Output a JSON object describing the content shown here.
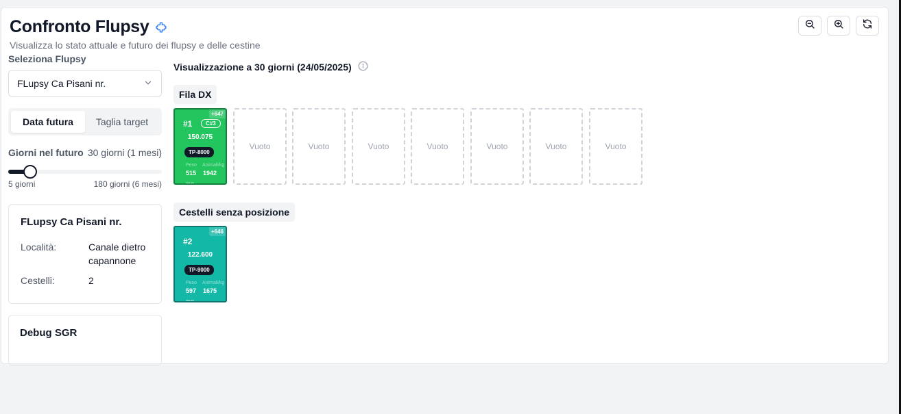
{
  "header": {
    "title": "Confronto Flupsy",
    "subtitle": "Visualizza lo stato attuale e futuro dei flupsy e delle cestine",
    "title_icon": "puzzle-icon"
  },
  "toolbar": {
    "buttons": [
      "zoom-out-icon",
      "zoom-in-icon",
      "refresh-icon"
    ]
  },
  "sidebar": {
    "select_label": "Seleziona Flupsy",
    "selected_flupsy": "FLupsy Ca Pisani nr.",
    "tabs": [
      {
        "label": "Data futura",
        "active": true
      },
      {
        "label": "Taglia target",
        "active": false
      }
    ],
    "days_label": "Giorni nel futuro",
    "days_value": "30 giorni (1 mesi)",
    "slider": {
      "min": 5,
      "max": 180,
      "value": 30
    },
    "range_min_label": "5 giorni",
    "range_max_label": "180 giorni (6 mesi)",
    "info_card": {
      "title": "FLupsy Ca Pisani nr.",
      "location_label": "Località:",
      "location_value": "Canale dietro capannone",
      "baskets_label": "Cestelli:",
      "baskets_value": "2"
    },
    "debug_title": "Debug SGR"
  },
  "main": {
    "viz_title": "Visualizzazione a 30 giorni (24/05/2025)",
    "row_dx": {
      "label": "Fila DX",
      "basket": {
        "plus": "+647",
        "number": "#1",
        "cycle": "C#3",
        "count": "150.075",
        "size": "TP-8000",
        "weight_label": "Peso",
        "weight_value": "515",
        "weight_unit": "mg",
        "animals_label": "Animali/kg",
        "animals_value": "1942",
        "color": "#22c55e"
      },
      "empty_label": "Vuoto",
      "empty_slots": 7
    },
    "unpositioned": {
      "label": "Cestelli senza posizione",
      "basket": {
        "plus": "+646",
        "number": "#2",
        "count": "122.600",
        "size": "TP-9000",
        "weight_label": "Peso",
        "weight_value": "597",
        "weight_unit": "mg",
        "animals_label": "Animali/kg",
        "animals_value": "1675",
        "color": "#14b8a6"
      }
    }
  }
}
